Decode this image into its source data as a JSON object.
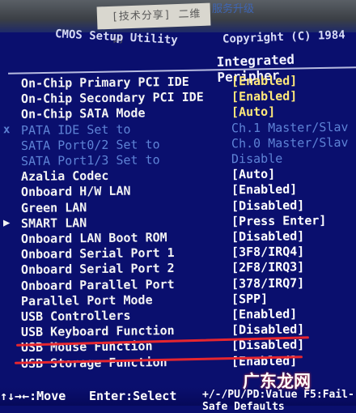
{
  "photo": {
    "sticker_text": "[技术分享] 二维码",
    "sticker_blue_text": "服务升级"
  },
  "header": {
    "left_partial": "CMOS Setup Utility",
    "right_partial": "Copyright (C) 1984",
    "section_title": "Integrated Peripher"
  },
  "rows": [
    {
      "marker": "",
      "label": "On-Chip Primary  PCI IDE",
      "value": "[Enabled]",
      "style": "highlight"
    },
    {
      "marker": "",
      "label": "On-Chip Secondary PCI IDE",
      "value": "[Enabled]",
      "style": "highlight"
    },
    {
      "marker": "",
      "label": "On-Chip SATA Mode",
      "value": "[Auto]",
      "style": "highlight"
    },
    {
      "marker": "x",
      "label": "PATA IDE Set to",
      "value": "Ch.1 Master/Slav",
      "style": "disabled"
    },
    {
      "marker": "",
      "label": "SATA Port0/2 Set to",
      "value": "Ch.0 Master/Slav",
      "style": "disabled"
    },
    {
      "marker": "",
      "label": "SATA Port1/3 Set to",
      "value": "Disable",
      "style": "disabled"
    },
    {
      "marker": "",
      "label": "Azalia Codec",
      "value": "[Auto]",
      "style": "normal"
    },
    {
      "marker": "",
      "label": "Onboard H/W LAN",
      "value": "[Enabled]",
      "style": "normal"
    },
    {
      "marker": "",
      "label": "Green LAN",
      "value": "[Disabled]",
      "style": "normal"
    },
    {
      "marker": "▶",
      "label": "SMART LAN",
      "value": "[Press Enter]",
      "style": "normal"
    },
    {
      "marker": "",
      "label": "Onboard LAN Boot ROM",
      "value": "[Disabled]",
      "style": "normal"
    },
    {
      "marker": "",
      "label": "Onboard Serial Port 1",
      "value": "[3F8/IRQ4]",
      "style": "normal"
    },
    {
      "marker": "",
      "label": "Onboard Serial Port 2",
      "value": "[2F8/IRQ3]",
      "style": "normal"
    },
    {
      "marker": "",
      "label": "Onboard Parallel Port",
      "value": "[378/IRQ7]",
      "style": "normal"
    },
    {
      "marker": "",
      "label": "Parallel Port Mode",
      "value": "[SPP]",
      "style": "normal"
    },
    {
      "marker": "",
      "label": "USB Controllers",
      "value": "[Enabled]",
      "style": "normal"
    },
    {
      "marker": "",
      "label": "USB Keyboard Function",
      "value": "[Disabled]",
      "style": "normal"
    },
    {
      "marker": "",
      "label": "USB Mouse Function",
      "value": "[Disabled]",
      "style": "normal"
    },
    {
      "marker": "",
      "label": "USB Storage Function",
      "value": "[Enabled]",
      "style": "normal"
    }
  ],
  "footer": {
    "move": "↑↓→←:Move",
    "select": "Enter:Select",
    "values": "+/-/PU/PD:Value  F5:Fail-Safe Defaults"
  },
  "watermark": "广东龙网",
  "colors": {
    "background": "#0a0f6e",
    "highlight_value": "#ffe97a",
    "disabled_text": "#5e83d6",
    "annotation_red": "#e6262f"
  }
}
